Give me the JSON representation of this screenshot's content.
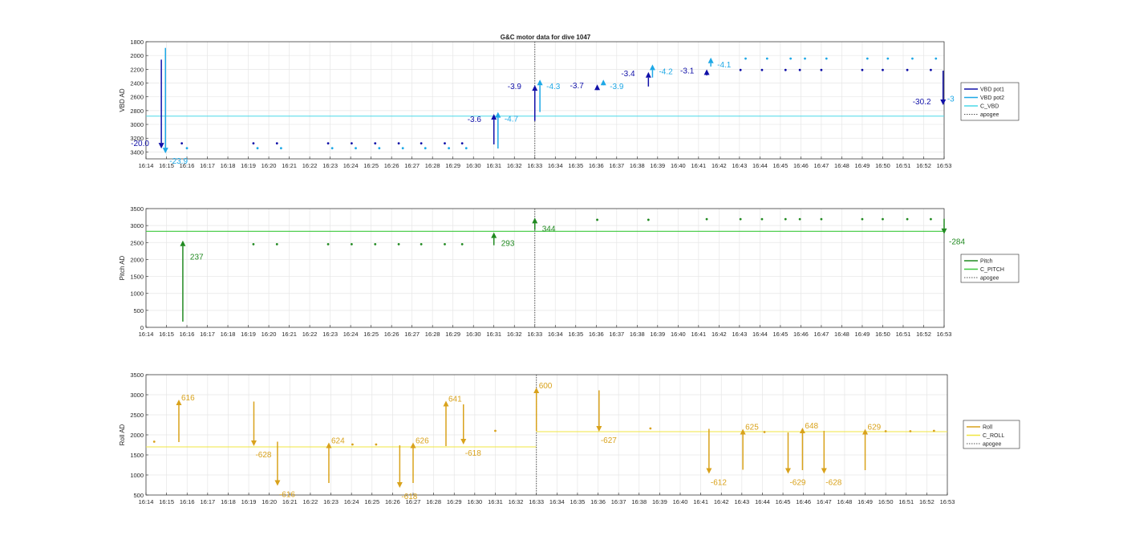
{
  "figure": {
    "title": "G&C motor data for dive 1047",
    "x_ticks": [
      "16:14",
      "16:15",
      "16:16",
      "16:17",
      "16:18",
      "16:19",
      "16:20",
      "16:21",
      "16:22",
      "16:23",
      "16:24",
      "16:25",
      "16:26",
      "16:27",
      "16:28",
      "16:29",
      "16:30",
      "16:31",
      "16:32",
      "16:33",
      "16:34",
      "16:35",
      "16:36",
      "16:37",
      "16:38",
      "16:39",
      "16:40",
      "16:41",
      "16:42",
      "16:43",
      "16:44",
      "16:45",
      "16:46",
      "16:47",
      "16:48",
      "16:49",
      "16:50",
      "16:51",
      "16:52",
      "16:53"
    ],
    "apogee_time": "16:33",
    "colors": {
      "vbd_pot1": "#1010a8",
      "vbd_pot2": "#1ea8e6",
      "c_vbd": "#4ad8e8",
      "pitch": "#218a21",
      "c_pitch": "#3cc83c",
      "roll": "#d9a21b",
      "c_roll": "#f0e640",
      "apogee": "#555555",
      "grid": "#e6e6e6"
    }
  },
  "chart_data": [
    {
      "type": "line",
      "ylabel": "VBD AD",
      "ylim": [
        1800,
        3500
      ],
      "y_reversed": true,
      "yticks": [
        1800,
        2000,
        2200,
        2400,
        2600,
        2800,
        3000,
        3200,
        3400
      ],
      "grid": true,
      "legend_placement": "right",
      "legend": [
        {
          "name": "VBD pot1",
          "key": "vbd_pot1",
          "style": "solid"
        },
        {
          "name": "VBD pot2",
          "key": "vbd_pot2",
          "style": "solid"
        },
        {
          "name": "C_VBD",
          "key": "c_vbd",
          "style": "solid"
        },
        {
          "name": "apogee",
          "key": "apogee",
          "style": "dotted"
        }
      ],
      "ref_lines": [
        {
          "key": "c_vbd",
          "segments": [
            {
              "x0": 14.0,
              "x1": 53.0,
              "y": 2880
            }
          ]
        }
      ],
      "arrows": [
        {
          "series": "vbd_pot1",
          "x": 14.75,
          "y0": 2060,
          "y1": 3350,
          "label": "-20.0",
          "label_dx": -38,
          "label_dy": -3
        },
        {
          "series": "vbd_pot2",
          "x": 14.95,
          "y0": 1890,
          "y1": 3420,
          "label": "-23.9",
          "label_dx": 5,
          "label_dy": 13
        },
        {
          "series": "vbd_pot1",
          "x": 31.0,
          "y0": 3290,
          "y1": 2850,
          "label": "-3.6",
          "label_dx": -33,
          "label_dy": 10
        },
        {
          "series": "vbd_pot2",
          "x": 31.2,
          "y0": 3350,
          "y1": 2820,
          "label": "-4.7",
          "label_dx": 8,
          "label_dy": 12
        },
        {
          "series": "vbd_pot1",
          "x": 33.0,
          "y0": 2950,
          "y1": 2430,
          "label": "-3.9",
          "label_dx": -34,
          "label_dy": 5
        },
        {
          "series": "vbd_pot2",
          "x": 33.25,
          "y0": 2820,
          "y1": 2350,
          "label": "-4.3",
          "label_dx": 8,
          "label_dy": 12
        },
        {
          "series": "vbd_pot1",
          "x": 36.05,
          "y0": 2490,
          "y1": 2420,
          "label": "-3.7",
          "label_dx": -34,
          "label_dy": 5
        },
        {
          "series": "vbd_pot2",
          "x": 36.35,
          "y0": 2410,
          "y1": 2350,
          "label": "-3.9",
          "label_dx": 8,
          "label_dy": 12
        },
        {
          "series": "vbd_pot1",
          "x": 38.55,
          "y0": 2450,
          "y1": 2240,
          "label": "-3.4",
          "label_dx": -34,
          "label_dy": 5
        },
        {
          "series": "vbd_pot2",
          "x": 38.75,
          "y0": 2320,
          "y1": 2130,
          "label": "-4.2",
          "label_dx": 8,
          "label_dy": 12
        },
        {
          "series": "vbd_pot1",
          "x": 41.4,
          "y0": 2290,
          "y1": 2200,
          "label": "-3.1",
          "label_dx": -33,
          "label_dy": 5
        },
        {
          "series": "vbd_pot2",
          "x": 41.6,
          "y0": 2160,
          "y1": 2030,
          "label": "-4.1",
          "label_dx": 8,
          "label_dy": 12
        },
        {
          "series": "vbd_pot1",
          "x": 52.95,
          "y0": 2220,
          "y1": 2720,
          "label": "-30.2",
          "label_dx": -38,
          "label_dy": -1
        },
        {
          "series": "vbd_pot2",
          "x": 53.15,
          "y0": null,
          "y1": null,
          "label": "-3",
          "label_dx": 0,
          "label_dy": 6
        }
      ],
      "points": [
        {
          "series": "vbd_pot1",
          "x": [
            15.75,
            19.25,
            20.4,
            22.9,
            24.05,
            25.2,
            26.35,
            27.45,
            28.6,
            29.45,
            43.05,
            44.1,
            45.25,
            45.95,
            47.0,
            49.0,
            50.0,
            51.2,
            52.35
          ],
          "y": [
            3275,
            3275,
            3275,
            3275,
            3275,
            3275,
            3275,
            3275,
            3275,
            3275,
            2210,
            2210,
            2210,
            2210,
            2210,
            2210,
            2210,
            2210,
            2210
          ]
        },
        {
          "series": "vbd_pot2",
          "x": [
            16.0,
            19.45,
            20.6,
            23.1,
            24.25,
            25.4,
            26.55,
            27.65,
            28.8,
            29.65,
            43.3,
            44.35,
            45.5,
            46.2,
            47.25,
            49.25,
            50.25,
            51.45,
            52.6
          ],
          "y": [
            3345,
            3345,
            3345,
            3345,
            3345,
            3345,
            3345,
            3345,
            3345,
            3345,
            2045,
            2045,
            2045,
            2045,
            2045,
            2045,
            2045,
            2045,
            2045
          ]
        }
      ]
    },
    {
      "type": "line",
      "ylabel": "Pitch AD",
      "ylim": [
        0,
        3500
      ],
      "y_reversed": false,
      "yticks": [
        0,
        500,
        1000,
        1500,
        2000,
        2500,
        3000,
        3500
      ],
      "grid": true,
      "legend_placement": "right",
      "legend": [
        {
          "name": "Pitch",
          "key": "pitch",
          "style": "solid"
        },
        {
          "name": "C_PITCH",
          "key": "c_pitch",
          "style": "solid"
        },
        {
          "name": "apogee",
          "key": "apogee",
          "style": "dotted"
        }
      ],
      "ref_lines": [
        {
          "key": "c_pitch",
          "segments": [
            {
              "x0": 14.0,
              "x1": 53.0,
              "y": 2830
            }
          ]
        }
      ],
      "arrows": [
        {
          "series": "pitch",
          "x": 15.8,
          "y0": 170,
          "y1": 2560,
          "label": "237",
          "label_dx": 9,
          "label_dy": 24
        },
        {
          "series": "pitch",
          "x": 31.0,
          "y0": 2420,
          "y1": 2800,
          "label": "293",
          "label_dx": 9,
          "label_dy": 17
        },
        {
          "series": "pitch",
          "x": 33.0,
          "y0": 2870,
          "y1": 3230,
          "label": "344",
          "label_dx": 9,
          "label_dy": 17
        },
        {
          "series": "pitch",
          "x": 53.0,
          "y0": 3200,
          "y1": 2750,
          "label": "-284",
          "label_dx": 6,
          "label_dy": 13
        }
      ],
      "points": [
        {
          "series": "pitch",
          "x": [
            19.25,
            20.4,
            22.9,
            24.05,
            25.2,
            26.35,
            27.45,
            28.6,
            29.45,
            36.05,
            38.55,
            41.4,
            43.05,
            44.1,
            45.25,
            45.95,
            47.0,
            49.0,
            50.0,
            51.2,
            52.35
          ],
          "y": [
            2450,
            2450,
            2450,
            2450,
            2450,
            2450,
            2450,
            2450,
            2450,
            3170,
            3170,
            3190,
            3190,
            3190,
            3190,
            3190,
            3190,
            3190,
            3190,
            3190,
            3190
          ]
        }
      ]
    },
    {
      "type": "line",
      "ylabel": "Roll AD",
      "ylim": [
        500,
        3500
      ],
      "y_reversed": false,
      "yticks": [
        500,
        1000,
        1500,
        2000,
        2500,
        3000,
        3500
      ],
      "grid": true,
      "legend_placement": "right",
      "legend": [
        {
          "name": "Roll",
          "key": "roll",
          "style": "solid"
        },
        {
          "name": "C_ROLL",
          "key": "c_roll",
          "style": "solid"
        },
        {
          "name": "apogee",
          "key": "apogee",
          "style": "dotted"
        }
      ],
      "ref_lines": [
        {
          "key": "c_roll",
          "segments": [
            {
              "x0": 14.0,
              "x1": 33.0,
              "y": 1700
            },
            {
              "x0": 33.0,
              "x1": 53.0,
              "y": 2080
            }
          ]
        }
      ],
      "arrows": [
        {
          "series": "roll",
          "x": 15.6,
          "y0": 1820,
          "y1": 2880,
          "label": "616",
          "label_dx": 3,
          "label_dy": 1
        },
        {
          "series": "roll",
          "x": 19.25,
          "y0": 2830,
          "y1": 1720,
          "label": "-628",
          "label_dx": 2,
          "label_dy": 14
        },
        {
          "series": "roll",
          "x": 20.4,
          "y0": 1830,
          "y1": 730,
          "label": "-616",
          "label_dx": 2,
          "label_dy": 14
        },
        {
          "series": "roll",
          "x": 22.9,
          "y0": 800,
          "y1": 1810,
          "label": "624",
          "label_dx": 3,
          "label_dy": 1
        },
        {
          "series": "roll",
          "x": 26.35,
          "y0": 1740,
          "y1": 680,
          "label": "-618",
          "label_dx": 2,
          "label_dy": 14
        },
        {
          "series": "roll",
          "x": 27.0,
          "y0": 800,
          "y1": 1810,
          "label": "626",
          "label_dx": 3,
          "label_dy": 1
        },
        {
          "series": "roll",
          "x": 28.6,
          "y0": 1720,
          "y1": 2850,
          "label": "641",
          "label_dx": 3,
          "label_dy": 1
        },
        {
          "series": "roll",
          "x": 29.45,
          "y0": 2760,
          "y1": 1760,
          "label": "-618",
          "label_dx": 2,
          "label_dy": 14
        },
        {
          "series": "roll",
          "x": 33.0,
          "y0": 2090,
          "y1": 3180,
          "label": "600",
          "label_dx": 3,
          "label_dy": 1
        },
        {
          "series": "roll",
          "x": 36.05,
          "y0": 3110,
          "y1": 2080,
          "label": "-627",
          "label_dx": 2,
          "label_dy": 14
        },
        {
          "series": "roll",
          "x": 41.4,
          "y0": 2150,
          "y1": 1030,
          "label": "-612",
          "label_dx": 2,
          "label_dy": 14
        },
        {
          "series": "roll",
          "x": 43.05,
          "y0": 1130,
          "y1": 2150,
          "label": "625",
          "label_dx": 3,
          "label_dy": 1
        },
        {
          "series": "roll",
          "x": 45.25,
          "y0": 2060,
          "y1": 1030,
          "label": "-629",
          "label_dx": 2,
          "label_dy": 14
        },
        {
          "series": "roll",
          "x": 45.95,
          "y0": 1120,
          "y1": 2180,
          "label": "648",
          "label_dx": 3,
          "label_dy": 1
        },
        {
          "series": "roll",
          "x": 47.0,
          "y0": 2100,
          "y1": 1030,
          "label": "-628",
          "label_dx": 2,
          "label_dy": 14
        },
        {
          "series": "roll",
          "x": 49.0,
          "y0": 1120,
          "y1": 2150,
          "label": "629",
          "label_dx": 3,
          "label_dy": 1
        }
      ],
      "points": [
        {
          "series": "roll",
          "x": [
            14.4,
            24.05,
            25.2,
            31.0,
            38.55,
            44.1,
            50.0,
            51.2,
            52.35
          ],
          "y": [
            1830,
            1760,
            1760,
            2100,
            2160,
            2070,
            2090,
            2090,
            2100
          ]
        }
      ]
    }
  ]
}
